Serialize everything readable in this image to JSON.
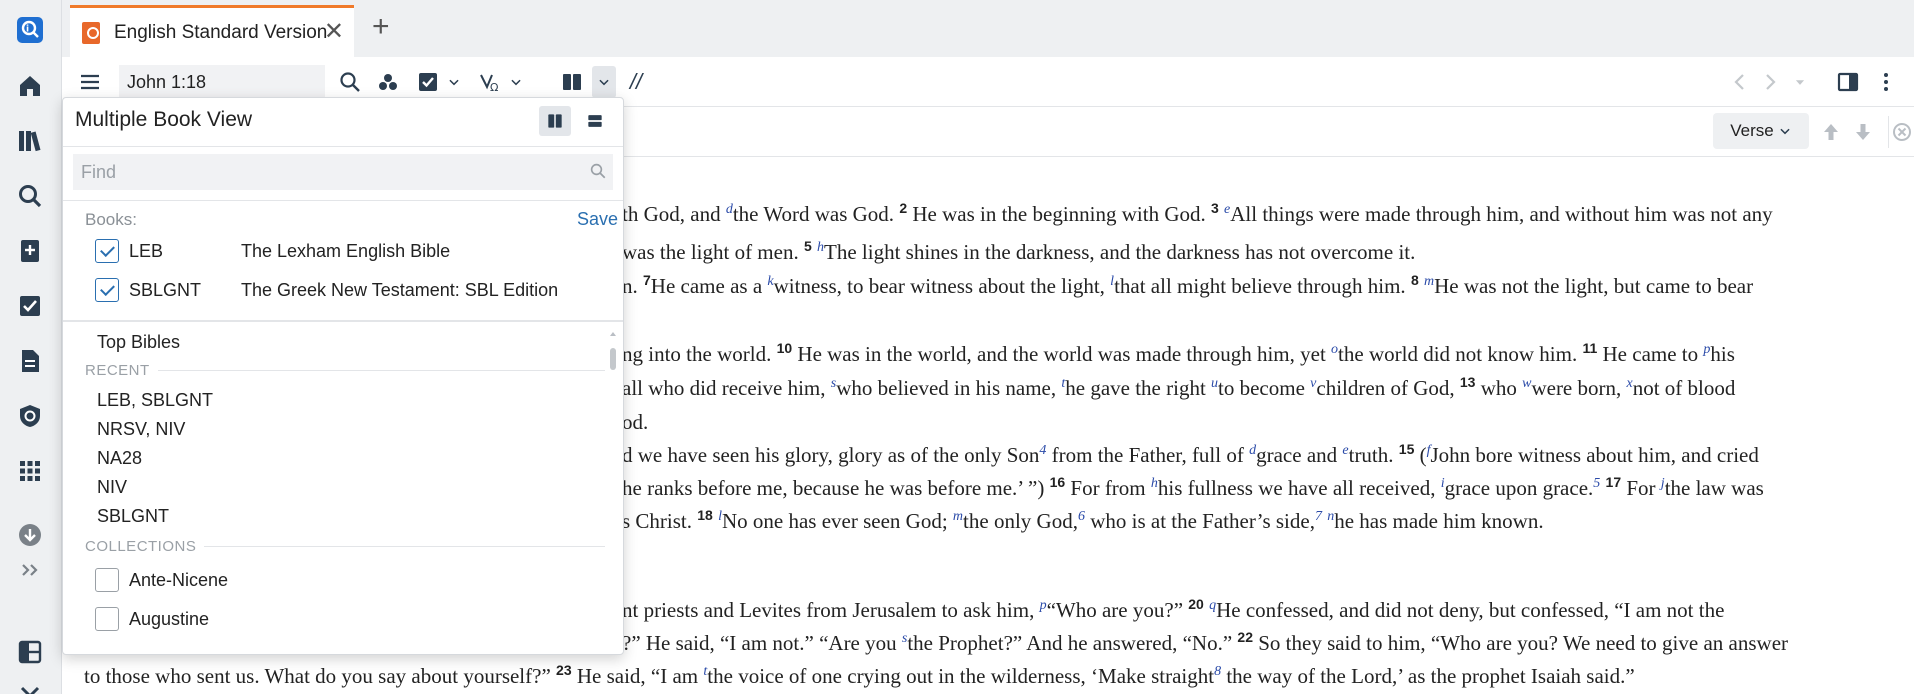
{
  "tab": {
    "title": "English Standard Version",
    "close": "✕",
    "add": "+"
  },
  "toolbar": {
    "reference": "John 1:18",
    "parallel_marks": "//"
  },
  "subbar": {
    "verse_button": "Verse"
  },
  "panel": {
    "title": "Multiple Book View",
    "find_placeholder": "Find",
    "books_label": "Books:",
    "save_label": "Save",
    "selected_books": [
      {
        "abbr": "LEB",
        "name": "The Lexham English Bible",
        "checked": true
      },
      {
        "abbr": "SBLGNT",
        "name": "The Greek New Testament: SBL Edition",
        "checked": true
      }
    ],
    "top_item": "Top Bibles",
    "recent_header": "RECENT",
    "recent": [
      "LEB, SBLGNT",
      "NRSV, NIV",
      "NA28",
      "NIV",
      "SBLGNT"
    ],
    "collections_header": "COLLECTIONS",
    "collections": [
      {
        "label": "Ante-Nicene",
        "checked": false
      },
      {
        "label": "Augustine",
        "checked": false
      }
    ]
  },
  "text": {
    "l1": [
      "th God, and ",
      "d",
      "the Word was God. ",
      "2",
      " He was in the beginning with God. ",
      "3",
      " ",
      "e",
      "All things were made through him, and without him was not any"
    ],
    "l2": [
      " was the light of men. ",
      "5",
      " ",
      "h",
      "The light shines in the darkness, and the darkness has not overcome it."
    ],
    "l3": [
      "n. ",
      "7",
      "He came as a ",
      "k",
      "witness, to bear witness about the light, ",
      "l",
      "that all might believe through him. ",
      "8",
      " ",
      "m",
      "He was not the light, but came to bear"
    ],
    "l4": [
      "ng into the world. ",
      "10",
      " He was in the world, and the world was made through him, yet ",
      "o",
      "the world did not know him. ",
      "11",
      " He came to ",
      "p",
      "his"
    ],
    "l5": [
      " all who did receive him, ",
      "s",
      "who believed in his name, ",
      "t",
      "he gave the right ",
      "u",
      "to become ",
      "v",
      "children of God, ",
      "13",
      " who ",
      "w",
      "were born, ",
      "x",
      "not of blood"
    ],
    "l6": [
      "od."
    ],
    "l7": [
      "d we have seen his glory, glory as of the only Son",
      "4",
      " from the Father, full of ",
      "d",
      "grace and ",
      "e",
      "truth. ",
      "15",
      " (",
      "f",
      "John bore witness about him, and cried"
    ],
    "l8": [
      "he ranks before me, because he was before me.’ ”) ",
      "16",
      " For from ",
      "h",
      "his fullness we have all received, ",
      "i",
      "grace upon grace.",
      "5",
      " ",
      "17",
      " For ",
      "j",
      "the law was"
    ],
    "l9": [
      "s Christ. ",
      "18",
      " ",
      "l",
      "No one has ever seen God; ",
      "m",
      "the only God,",
      "6",
      " who is at the Father’s side,",
      "7",
      " ",
      "n",
      "he has made him known."
    ],
    "l10": [
      "nt priests and Levites from Jerusalem to ask him, ",
      "p",
      "“Who are you?” ",
      "20",
      " ",
      "q",
      "He confessed, and did not deny, but confessed, “I am not the"
    ],
    "l11": [
      "?” He said, “I am not.” “Are you ",
      "s",
      "the Prophet?” And he answered, “No.” ",
      "22",
      " So they said to him, “Who are you? We need to give an answer"
    ],
    "l12": [
      "to those who sent us. What do you say about yourself?” ",
      "23",
      " He said, “I am ",
      "t",
      "the voice of one crying out in the wilderness, ‘Make straight",
      "8",
      " the way of the Lord,’ as the prophet Isaiah said.”"
    ]
  }
}
